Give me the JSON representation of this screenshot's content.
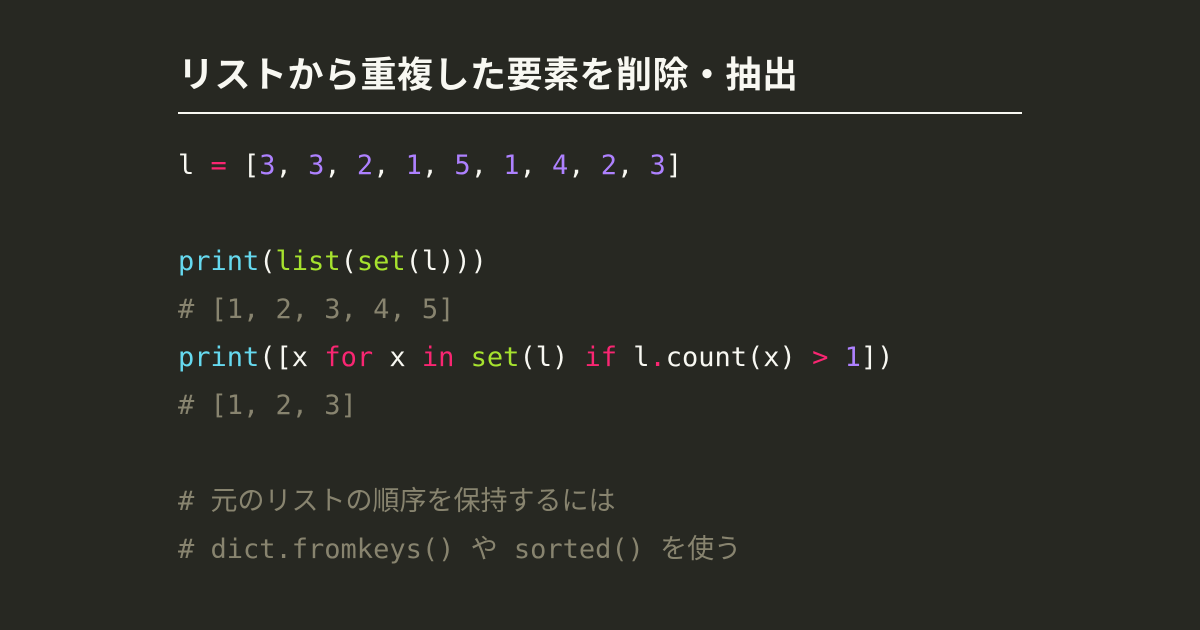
{
  "title": "リストから重複した要素を削除・抽出",
  "code": {
    "lines": [
      {
        "type": "code",
        "tokens": [
          {
            "t": "l ",
            "c": "def"
          },
          {
            "t": "=",
            "c": "op"
          },
          {
            "t": " [",
            "c": "def"
          },
          {
            "t": "3",
            "c": "num"
          },
          {
            "t": ", ",
            "c": "def"
          },
          {
            "t": "3",
            "c": "num"
          },
          {
            "t": ", ",
            "c": "def"
          },
          {
            "t": "2",
            "c": "num"
          },
          {
            "t": ", ",
            "c": "def"
          },
          {
            "t": "1",
            "c": "num"
          },
          {
            "t": ", ",
            "c": "def"
          },
          {
            "t": "5",
            "c": "num"
          },
          {
            "t": ", ",
            "c": "def"
          },
          {
            "t": "1",
            "c": "num"
          },
          {
            "t": ", ",
            "c": "def"
          },
          {
            "t": "4",
            "c": "num"
          },
          {
            "t": ", ",
            "c": "def"
          },
          {
            "t": "2",
            "c": "num"
          },
          {
            "t": ", ",
            "c": "def"
          },
          {
            "t": "3",
            "c": "num"
          },
          {
            "t": "]",
            "c": "def"
          }
        ]
      },
      {
        "type": "blank"
      },
      {
        "type": "code",
        "tokens": [
          {
            "t": "print",
            "c": "fn"
          },
          {
            "t": "(",
            "c": "def"
          },
          {
            "t": "list",
            "c": "fn2"
          },
          {
            "t": "(",
            "c": "def"
          },
          {
            "t": "set",
            "c": "fn2"
          },
          {
            "t": "(l)))",
            "c": "def"
          }
        ]
      },
      {
        "type": "comment",
        "text": "# [1, 2, 3, 4, 5]"
      },
      {
        "type": "code",
        "tokens": [
          {
            "t": "print",
            "c": "fn"
          },
          {
            "t": "([x ",
            "c": "def"
          },
          {
            "t": "for",
            "c": "op"
          },
          {
            "t": " x ",
            "c": "def"
          },
          {
            "t": "in",
            "c": "op"
          },
          {
            "t": " ",
            "c": "def"
          },
          {
            "t": "set",
            "c": "fn2"
          },
          {
            "t": "(l) ",
            "c": "def"
          },
          {
            "t": "if",
            "c": "op"
          },
          {
            "t": " l",
            "c": "def"
          },
          {
            "t": ".",
            "c": "op"
          },
          {
            "t": "count(x) ",
            "c": "def"
          },
          {
            "t": ">",
            "c": "op"
          },
          {
            "t": " ",
            "c": "def"
          },
          {
            "t": "1",
            "c": "num"
          },
          {
            "t": "])",
            "c": "def"
          }
        ]
      },
      {
        "type": "comment",
        "text": "# [1, 2, 3]"
      },
      {
        "type": "blank"
      },
      {
        "type": "comment",
        "text": "# 元のリストの順序を保持するには"
      },
      {
        "type": "comment",
        "text": "# dict.fromkeys() や sorted() を使う"
      }
    ]
  }
}
